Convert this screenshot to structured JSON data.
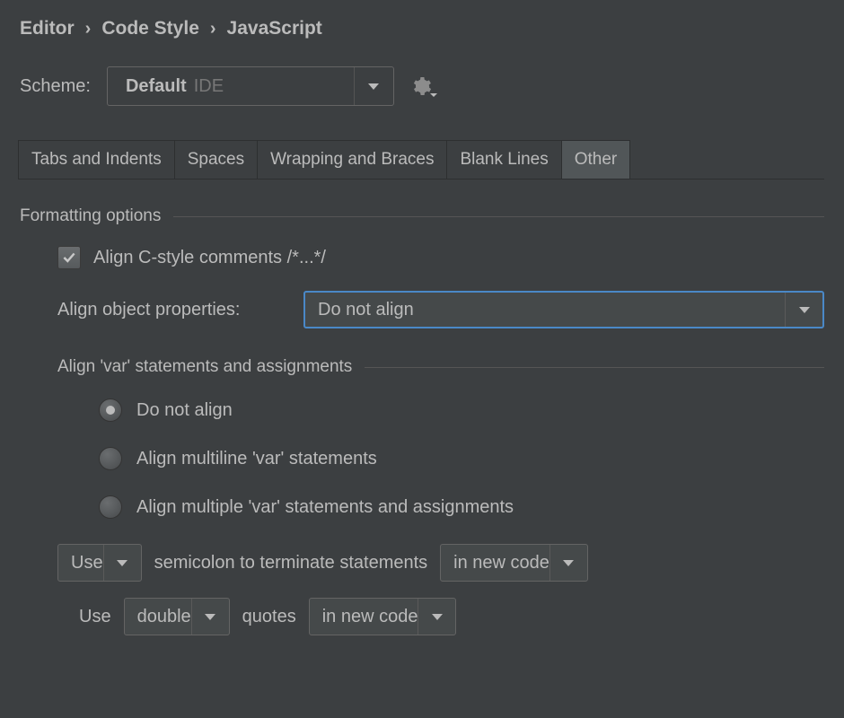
{
  "breadcrumb": {
    "items": [
      "Editor",
      "Code Style",
      "JavaScript"
    ]
  },
  "scheme": {
    "label": "Scheme:",
    "value": "Default",
    "suffix": "IDE"
  },
  "tabs": {
    "items": [
      "Tabs and Indents",
      "Spaces",
      "Wrapping and Braces",
      "Blank Lines",
      "Other"
    ],
    "active": 4
  },
  "formatting": {
    "title": "Formatting options",
    "align_c_comments": {
      "label": "Align C-style comments /*...*/",
      "checked": true
    },
    "align_object_props": {
      "label": "Align object properties:",
      "value": "Do not align"
    },
    "align_var": {
      "title": "Align 'var' statements and assignments",
      "options": [
        "Do not align",
        "Align multiline 'var' statements",
        "Align multiple 'var' statements and assignments"
      ],
      "selected": 0
    },
    "semicolon": {
      "use_value": "Use",
      "middle_text": "semicolon to terminate statements",
      "scope_value": "in new code"
    },
    "quotes": {
      "prefix": "Use",
      "type_value": "double",
      "middle_text": "quotes",
      "scope_value": "in new code"
    }
  }
}
